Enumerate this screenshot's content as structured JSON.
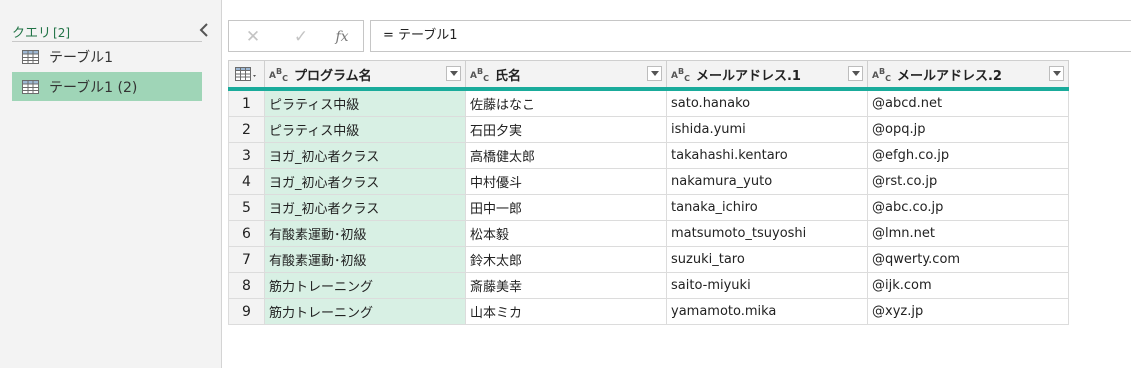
{
  "queries": {
    "header": "クエリ",
    "count": "[2]",
    "items": [
      {
        "label": "テーブル1",
        "selected": false
      },
      {
        "label": "テーブル1 (2)",
        "selected": true
      }
    ]
  },
  "formula_bar": {
    "cancel": "✕",
    "confirm": "✓",
    "fx": "fx",
    "formula": "= テーブル1"
  },
  "table": {
    "columns": [
      {
        "type": "ABC",
        "label": "プログラム名"
      },
      {
        "type": "ABC",
        "label": "氏名"
      },
      {
        "type": "ABC",
        "label": "メールアドレス.1"
      },
      {
        "type": "ABC",
        "label": "メールアドレス.2"
      }
    ],
    "rows": [
      [
        "1",
        "ピラティス中級",
        "佐藤はなこ",
        "sato.hanako",
        "@abcd.net"
      ],
      [
        "2",
        "ピラティス中級",
        "石田夕実",
        "ishida.yumi",
        "@opq.jp"
      ],
      [
        "3",
        "ヨガ_初心者クラス",
        "高橋健太郎",
        "takahashi.kentaro",
        "@efgh.co.jp"
      ],
      [
        "4",
        "ヨガ_初心者クラス",
        "中村優斗",
        "nakamura_yuto",
        "@rst.co.jp"
      ],
      [
        "5",
        "ヨガ_初心者クラス",
        "田中一郎",
        "tanaka_ichiro",
        "@abc.co.jp"
      ],
      [
        "6",
        "有酸素運動･初級",
        "松本毅",
        "matsumoto_tsuyoshi",
        "@lmn.net"
      ],
      [
        "7",
        "有酸素運動･初級",
        "鈴木太郎",
        "suzuki_taro",
        "@qwerty.com"
      ],
      [
        "8",
        "筋力トレーニング",
        "斎藤美幸",
        "saito-miyuki",
        "@ijk.com"
      ],
      [
        "9",
        "筋力トレーニング",
        "山本ミカ",
        "yamamoto.mika",
        "@xyz.jp"
      ]
    ]
  },
  "colors": {
    "accent": "#217346",
    "selected_query": "#9fd5b7",
    "selected_column": "#d8f0e4",
    "header_rule": "#1aab9b"
  }
}
